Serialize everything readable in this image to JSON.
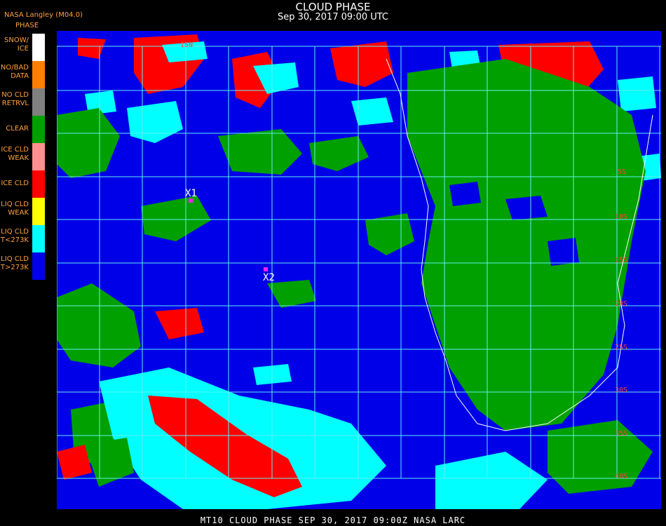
{
  "header": {
    "title": "CLOUD PHASE",
    "subtitle": "Sep 30, 2017 09:00 UTC",
    "org": "NASA Langley (M04.0)",
    "legend_heading": "PHASE"
  },
  "legend": [
    {
      "label": "SNOW/\nICE",
      "color": "#ffffff"
    },
    {
      "label": "NO/BAD\nDATA",
      "color": "#ff8000"
    },
    {
      "label": "NO CLD\nRETRVL",
      "color": "#808080"
    },
    {
      "label": "CLEAR",
      "color": "#00a000"
    },
    {
      "label": "ICE CLD\nWEAK",
      "color": "#ff9090"
    },
    {
      "label": "ICE CLD",
      "color": "#ff0000"
    },
    {
      "label": "LIQ CLD\nWEAK",
      "color": "#ffff00"
    },
    {
      "label": "LIQ CLD\nT<273K",
      "color": "#00ffff"
    },
    {
      "label": "LIQ CLD\nT>273K",
      "color": "#0000e8"
    }
  ],
  "markers": [
    {
      "label": "X1"
    },
    {
      "label": "X2"
    }
  ],
  "grid_labels": [
    "15N",
    "5S",
    "10S",
    "15S",
    "20S",
    "25S",
    "30S",
    "35S",
    "40S"
  ],
  "footer": "MT10  CLOUD PHASE  SEP 30, 2017 09:00Z  NASA LARC"
}
